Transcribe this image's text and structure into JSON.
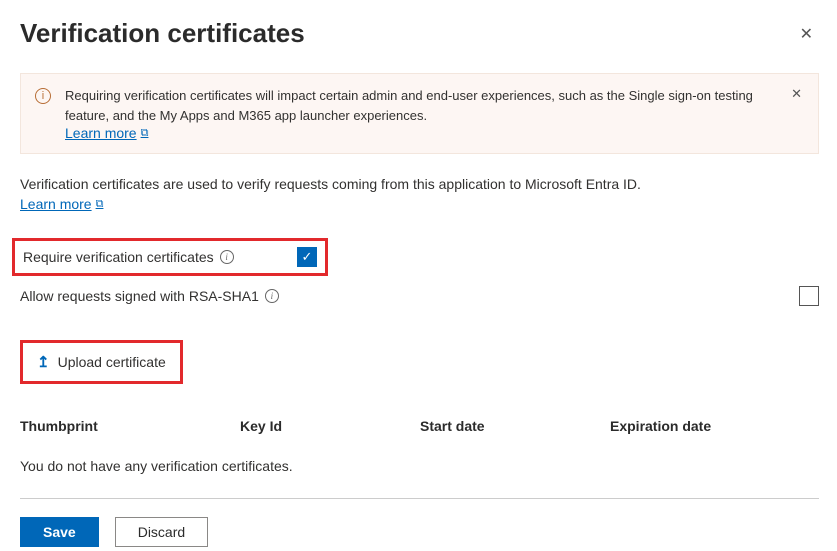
{
  "header": {
    "title": "Verification certificates"
  },
  "banner": {
    "text": "Requiring verification certificates will impact certain admin and end-user experiences, such as the Single sign-on testing feature, and the My Apps and M365 app launcher experiences.",
    "learn_more": "Learn more"
  },
  "description": {
    "text": "Verification certificates are used to verify requests coming from this application to Microsoft Entra ID.",
    "learn_more": "Learn more"
  },
  "options": {
    "require_label": "Require verification certificates",
    "require_checked": true,
    "allow_rsa_label": "Allow requests signed with RSA-SHA1",
    "allow_rsa_checked": false
  },
  "upload": {
    "label": "Upload certificate"
  },
  "table": {
    "columns": {
      "thumbprint": "Thumbprint",
      "key_id": "Key Id",
      "start_date": "Start date",
      "expiration_date": "Expiration date"
    },
    "empty_message": "You do not have any verification certificates."
  },
  "footer": {
    "save": "Save",
    "discard": "Discard"
  }
}
